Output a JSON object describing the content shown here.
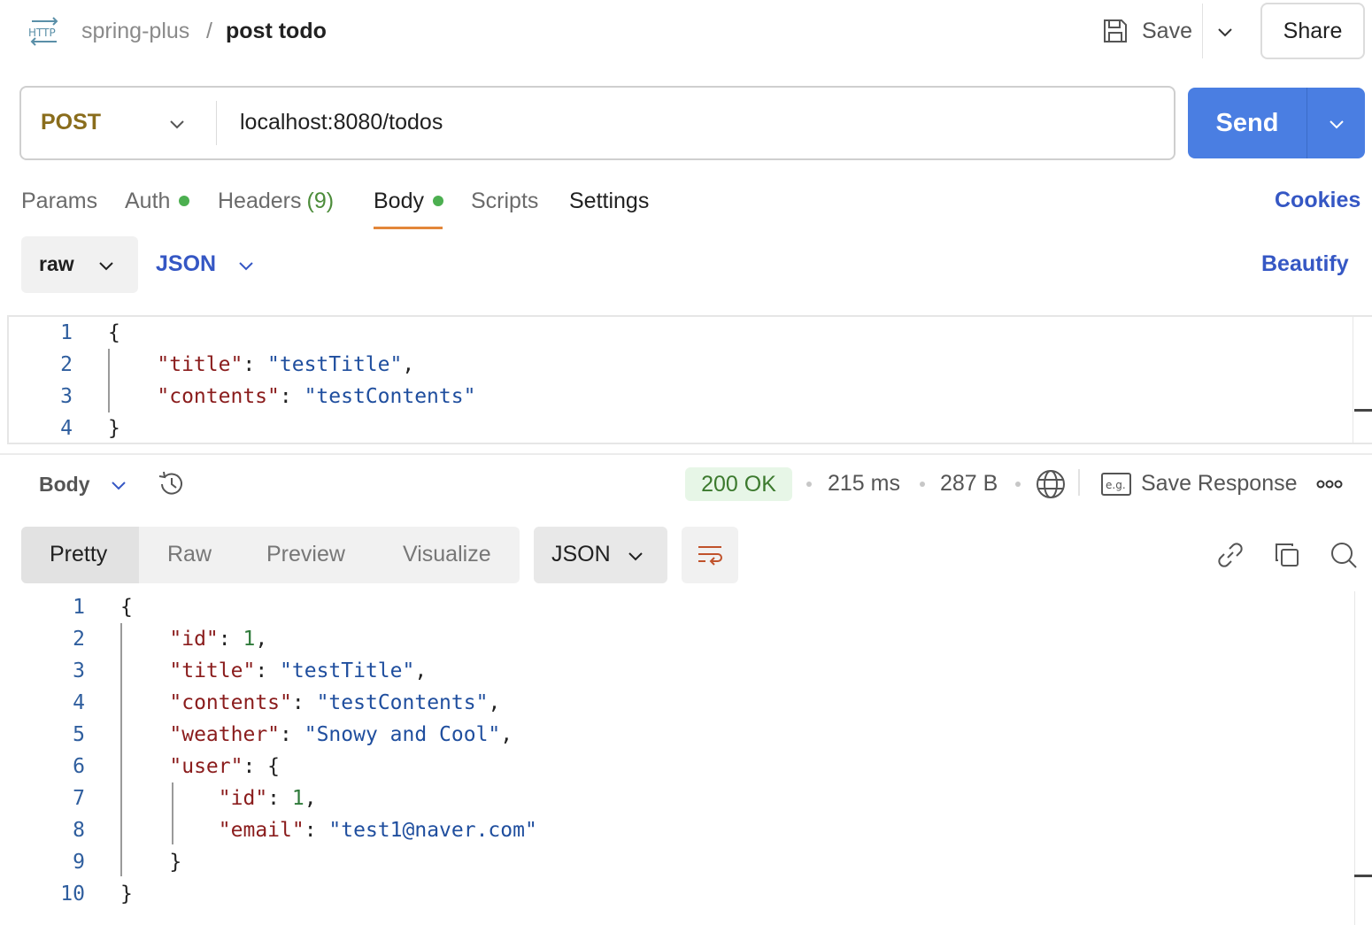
{
  "header": {
    "collection": "spring-plus",
    "separator": "/",
    "request_name": "post todo",
    "save_label": "Save",
    "share_label": "Share"
  },
  "request": {
    "method": "POST",
    "url": "localhost:8080/todos",
    "send_label": "Send"
  },
  "tabs": {
    "params": "Params",
    "auth": "Auth",
    "headers": "Headers",
    "headers_count": "(9)",
    "body": "Body",
    "scripts": "Scripts",
    "settings": "Settings",
    "cookies": "Cookies"
  },
  "body_options": {
    "mode": "raw",
    "language": "JSON",
    "beautify": "Beautify"
  },
  "request_body": {
    "line_numbers": [
      "1",
      "2",
      "3",
      "4"
    ],
    "lines": [
      [
        {
          "t": "{",
          "c": "punc"
        }
      ],
      [
        {
          "t": "\"title\"",
          "c": "key"
        },
        {
          "t": ": ",
          "c": "punc"
        },
        {
          "t": "\"testTitle\"",
          "c": "str"
        },
        {
          "t": ",",
          "c": "punc"
        }
      ],
      [
        {
          "t": "\"contents\"",
          "c": "key"
        },
        {
          "t": ": ",
          "c": "punc"
        },
        {
          "t": "\"testContents\"",
          "c": "str"
        }
      ],
      [
        {
          "t": "}",
          "c": "punc"
        }
      ]
    ]
  },
  "response": {
    "section_label": "Body",
    "status": "200 OK",
    "time": "215 ms",
    "size": "287 B",
    "save_response": "Save Response",
    "view_tabs": [
      "Pretty",
      "Raw",
      "Preview",
      "Visualize"
    ],
    "format": "JSON",
    "line_numbers": [
      "1",
      "2",
      "3",
      "4",
      "5",
      "6",
      "7",
      "8",
      "9",
      "10"
    ],
    "lines": [
      [
        {
          "t": "{",
          "c": "punc"
        }
      ],
      [
        {
          "t": "\"id\"",
          "c": "key"
        },
        {
          "t": ": ",
          "c": "punc"
        },
        {
          "t": "1",
          "c": "num"
        },
        {
          "t": ",",
          "c": "punc"
        }
      ],
      [
        {
          "t": "\"title\"",
          "c": "key"
        },
        {
          "t": ": ",
          "c": "punc"
        },
        {
          "t": "\"testTitle\"",
          "c": "str"
        },
        {
          "t": ",",
          "c": "punc"
        }
      ],
      [
        {
          "t": "\"contents\"",
          "c": "key"
        },
        {
          "t": ": ",
          "c": "punc"
        },
        {
          "t": "\"testContents\"",
          "c": "str"
        },
        {
          "t": ",",
          "c": "punc"
        }
      ],
      [
        {
          "t": "\"weather\"",
          "c": "key"
        },
        {
          "t": ": ",
          "c": "punc"
        },
        {
          "t": "\"Snowy and Cool\"",
          "c": "str"
        },
        {
          "t": ",",
          "c": "punc"
        }
      ],
      [
        {
          "t": "\"user\"",
          "c": "key"
        },
        {
          "t": ": {",
          "c": "punc"
        }
      ],
      [
        {
          "t": "\"id\"",
          "c": "key"
        },
        {
          "t": ": ",
          "c": "punc"
        },
        {
          "t": "1",
          "c": "num"
        },
        {
          "t": ",",
          "c": "punc"
        }
      ],
      [
        {
          "t": "\"email\"",
          "c": "key"
        },
        {
          "t": ": ",
          "c": "punc"
        },
        {
          "t": "\"test1@naver.com\"",
          "c": "str"
        }
      ],
      [
        {
          "t": "}",
          "c": "punc"
        }
      ],
      [
        {
          "t": "}",
          "c": "punc"
        }
      ]
    ]
  },
  "colors": {
    "accent": "#4a7ee2",
    "method": "#8a6d1c",
    "status_ok": "#3c7a2e",
    "tab_underline": "#e3873a"
  }
}
